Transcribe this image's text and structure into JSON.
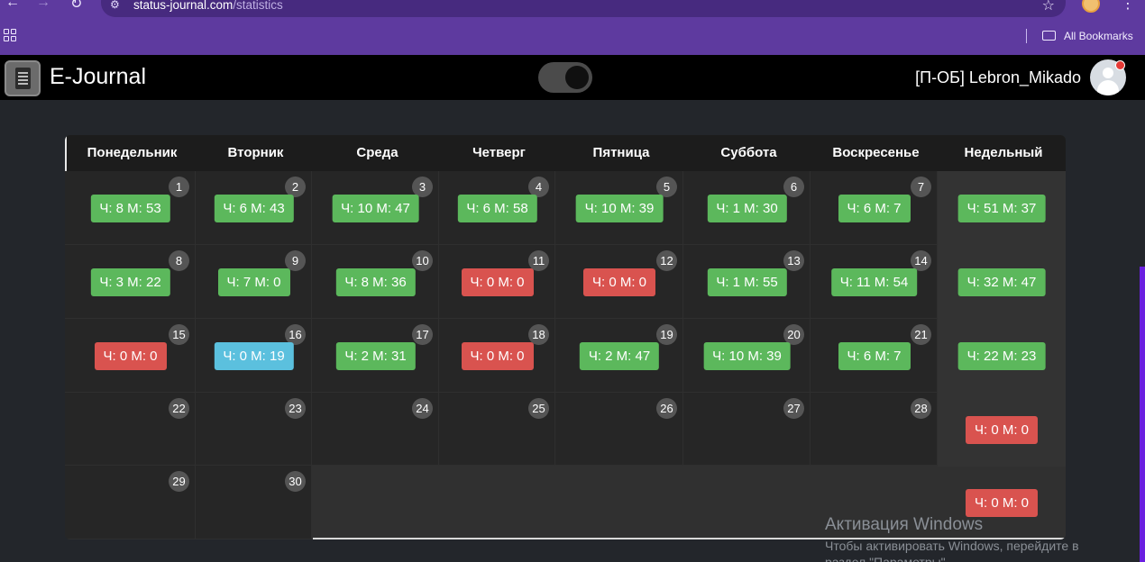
{
  "browser": {
    "url_host": "status-journal.com",
    "url_path": "/statistics",
    "bookmarks_label": "All Bookmarks",
    "icons": {
      "back": "arrow-left-icon",
      "forward": "arrow-right-icon",
      "reload": "reload-icon",
      "site_info": "tune-icon",
      "star": "star-icon",
      "menu": "more-vert-icon",
      "apps": "apps-grid-icon",
      "folder": "folder-icon"
    },
    "colors": {
      "frame": "#5e3a9f",
      "omnibox": "#472a7f"
    }
  },
  "app": {
    "title": "E-Journal",
    "user_name": "[П-ОБ] Lebron_Mikado",
    "theme_toggle_on": true,
    "icons": {
      "logo": "journal-logo-icon",
      "avatar": "user-avatar-icon",
      "toggle": "theme-toggle"
    }
  },
  "calendar": {
    "headers": [
      "Понедельник",
      "Вторник",
      "Среда",
      "Четверг",
      "Пятница",
      "Суббота",
      "Воскресенье",
      "Недельный"
    ],
    "weeks": [
      {
        "days": [
          {
            "num": "1",
            "label": "Ч: 8 М: 53",
            "status": "green"
          },
          {
            "num": "2",
            "label": "Ч: 6 М: 43",
            "status": "green"
          },
          {
            "num": "3",
            "label": "Ч: 10 М: 47",
            "status": "green"
          },
          {
            "num": "4",
            "label": "Ч: 6 М: 58",
            "status": "green"
          },
          {
            "num": "5",
            "label": "Ч: 10 М: 39",
            "status": "green"
          },
          {
            "num": "6",
            "label": "Ч: 1 М: 30",
            "status": "green"
          },
          {
            "num": "7",
            "label": "Ч: 6 М: 7",
            "status": "green"
          }
        ],
        "weekly": {
          "label": "Ч: 51 М: 37",
          "status": "green"
        }
      },
      {
        "days": [
          {
            "num": "8",
            "label": "Ч: 3 М: 22",
            "status": "green"
          },
          {
            "num": "9",
            "label": "Ч: 7 М: 0",
            "status": "green"
          },
          {
            "num": "10",
            "label": "Ч: 8 М: 36",
            "status": "green"
          },
          {
            "num": "11",
            "label": "Ч: 0 М: 0",
            "status": "red"
          },
          {
            "num": "12",
            "label": "Ч: 0 М: 0",
            "status": "red"
          },
          {
            "num": "13",
            "label": "Ч: 1 М: 55",
            "status": "green"
          },
          {
            "num": "14",
            "label": "Ч: 11 М: 54",
            "status": "green"
          }
        ],
        "weekly": {
          "label": "Ч: 32 М: 47",
          "status": "green"
        }
      },
      {
        "days": [
          {
            "num": "15",
            "label": "Ч: 0 М: 0",
            "status": "red"
          },
          {
            "num": "16",
            "label": "Ч: 0 М: 19",
            "status": "blue"
          },
          {
            "num": "17",
            "label": "Ч: 2 М: 31",
            "status": "green"
          },
          {
            "num": "18",
            "label": "Ч: 0 М: 0",
            "status": "red"
          },
          {
            "num": "19",
            "label": "Ч: 2 М: 47",
            "status": "green"
          },
          {
            "num": "20",
            "label": "Ч: 10 М: 39",
            "status": "green"
          },
          {
            "num": "21",
            "label": "Ч: 6 М: 7",
            "status": "green"
          }
        ],
        "weekly": {
          "label": "Ч: 22 М: 23",
          "status": "green"
        }
      },
      {
        "days": [
          {
            "num": "22",
            "label": "",
            "status": ""
          },
          {
            "num": "23",
            "label": "",
            "status": ""
          },
          {
            "num": "24",
            "label": "",
            "status": ""
          },
          {
            "num": "25",
            "label": "",
            "status": ""
          },
          {
            "num": "26",
            "label": "",
            "status": ""
          },
          {
            "num": "27",
            "label": "",
            "status": ""
          },
          {
            "num": "28",
            "label": "",
            "status": ""
          }
        ],
        "weekly": {
          "label": "Ч: 0 М: 0",
          "status": "red"
        }
      },
      {
        "days": [
          {
            "num": "29",
            "label": "",
            "status": ""
          },
          {
            "num": "30",
            "label": "",
            "status": ""
          }
        ],
        "weekly": {
          "label": "Ч: 0 М: 0",
          "status": "red"
        }
      }
    ],
    "colors": {
      "green": "#5cb85c",
      "red": "#d9534f",
      "blue": "#5bc0de"
    }
  },
  "watermark": {
    "title": "Активация Windows",
    "line1": "Чтобы активировать Windows, перейдите в",
    "line2": "раздел \"Параметры\"."
  }
}
